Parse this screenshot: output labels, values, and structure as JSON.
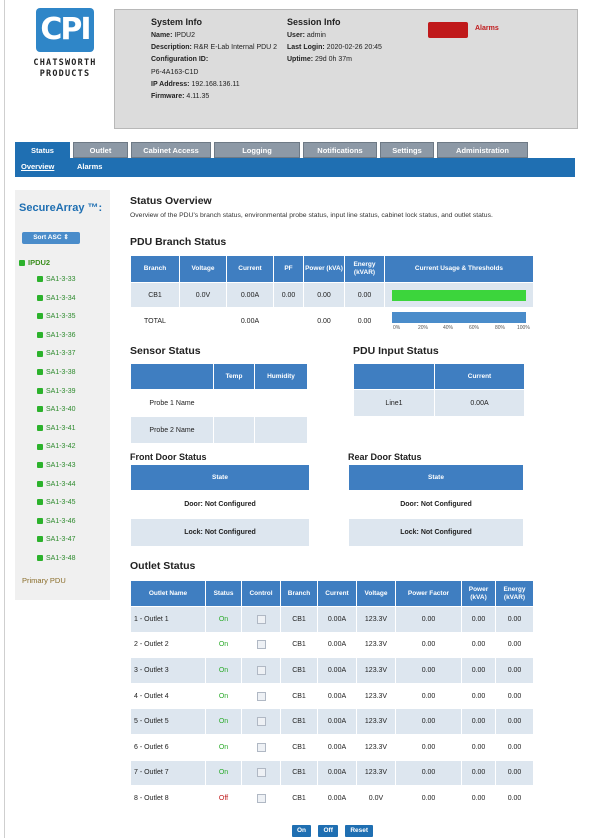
{
  "brand": {
    "logo_text_line1": "CHATSWORTH",
    "logo_text_line2": "PRODUCTS"
  },
  "system_info": {
    "title": "System Info",
    "name_label": "Name:",
    "name": "IPDU2",
    "desc_label": "Description:",
    "desc": "R&R E-Lab Internal PDU 2",
    "config_label": "Configuration ID:",
    "config": "P6-4A163-C1D",
    "ip_label": "IP Address:",
    "ip": "192.168.136.11",
    "fw_label": "Firmware:",
    "fw": "4.11.35"
  },
  "session_info": {
    "title": "Session Info",
    "user_label": "User:",
    "user": "admin",
    "login_label": "Last Login:",
    "login": "2020-02-26 20:45",
    "uptime_label": "Uptime:",
    "uptime": "29d 0h 37m"
  },
  "alarms_label": "Alarms",
  "tabs": [
    "Status",
    "Outlet",
    "Cabinet Access",
    "Logging",
    "Notifications",
    "Settings",
    "Administration"
  ],
  "subnav": [
    "Overview",
    "Alarms"
  ],
  "sidebar": {
    "title": "SecureArray ™:",
    "sort_label": "Sort ASC ⇕",
    "root": "IPDU2",
    "items": [
      "SA1-3-33",
      "SA1-3-34",
      "SA1-3-35",
      "SA1-3-36",
      "SA1-3-37",
      "SA1-3-38",
      "SA1-3-39",
      "SA1-3-40",
      "SA1-3-41",
      "SA1-3-42",
      "SA1-3-43",
      "SA1-3-44",
      "SA1-3-45",
      "SA1-3-46",
      "SA1-3-47",
      "SA1-3-48"
    ],
    "primary": "Primary PDU"
  },
  "overview": {
    "title": "Status Overview",
    "desc": "Overview of the PDU's branch status, environmental probe status, input line status, cabinet lock status, and outlet status."
  },
  "branch": {
    "title": "PDU Branch Status",
    "headers": [
      "Branch",
      "Voltage",
      "Current",
      "PF",
      "Power (kVA)",
      "Energy (kVAR)",
      "Current Usage & Thresholds"
    ],
    "row": {
      "branch": "CB1",
      "voltage": "0.0V",
      "current": "0.00A",
      "pf": "0.00",
      "power": "0.00",
      "energy": "0.00"
    },
    "total": {
      "label": "TOTAL",
      "current": "0.00A",
      "power": "0.00",
      "energy": "0.00"
    },
    "usage_fraction": 1.0,
    "scale": [
      "0%",
      "20%",
      "40%",
      "60%",
      "80%",
      "100%"
    ]
  },
  "sensor": {
    "title": "Sensor Status",
    "headers": [
      "",
      "Temp",
      "Humidity"
    ],
    "rows": [
      "Probe 1 Name",
      "Probe 2 Name"
    ]
  },
  "input": {
    "title": "PDU Input Status",
    "headers": [
      "",
      "Current"
    ],
    "row": {
      "line": "Line1",
      "current": "0.00A"
    }
  },
  "front_door": {
    "title": "Front Door Status",
    "header": "State",
    "door": "Door: Not Configured",
    "lock": "Lock: Not Configured"
  },
  "rear_door": {
    "title": "Rear Door Status",
    "header": "State",
    "door": "Door: Not Configured",
    "lock": "Lock: Not Configured"
  },
  "outlets": {
    "title": "Outlet Status",
    "headers": [
      "Outlet Name",
      "Status",
      "Control",
      "Branch",
      "Current",
      "Voltage",
      "Power Factor",
      "Power (kVA)",
      "Energy (kVAR)"
    ],
    "rows": [
      {
        "name": "1 - Outlet 1",
        "status": "On",
        "branch": "CB1",
        "current": "0.00A",
        "voltage": "123.3V",
        "pf": "0.00",
        "power": "0.00",
        "energy": "0.00"
      },
      {
        "name": "2 - Outlet 2",
        "status": "On",
        "branch": "CB1",
        "current": "0.00A",
        "voltage": "123.3V",
        "pf": "0.00",
        "power": "0.00",
        "energy": "0.00"
      },
      {
        "name": "3 - Outlet 3",
        "status": "On",
        "branch": "CB1",
        "current": "0.00A",
        "voltage": "123.3V",
        "pf": "0.00",
        "power": "0.00",
        "energy": "0.00"
      },
      {
        "name": "4 - Outlet 4",
        "status": "On",
        "branch": "CB1",
        "current": "0.00A",
        "voltage": "123.3V",
        "pf": "0.00",
        "power": "0.00",
        "energy": "0.00"
      },
      {
        "name": "5 - Outlet 5",
        "status": "On",
        "branch": "CB1",
        "current": "0.00A",
        "voltage": "123.3V",
        "pf": "0.00",
        "power": "0.00",
        "energy": "0.00"
      },
      {
        "name": "6 - Outlet 6",
        "status": "On",
        "branch": "CB1",
        "current": "0.00A",
        "voltage": "123.3V",
        "pf": "0.00",
        "power": "0.00",
        "energy": "0.00"
      },
      {
        "name": "7 - Outlet 7",
        "status": "On",
        "branch": "CB1",
        "current": "0.00A",
        "voltage": "123.3V",
        "pf": "0.00",
        "power": "0.00",
        "energy": "0.00"
      },
      {
        "name": "8 - Outlet 8",
        "status": "Off",
        "branch": "CB1",
        "current": "0.00A",
        "voltage": "0.0V",
        "pf": "0.00",
        "power": "0.00",
        "energy": "0.00"
      }
    ]
  },
  "actions": [
    "On",
    "Off",
    "Reset"
  ],
  "colors": {
    "accent": "#1f6fb2",
    "header_blue": "#3f7ec1",
    "alarm": "#c0191b",
    "ok": "#2cb22c"
  }
}
